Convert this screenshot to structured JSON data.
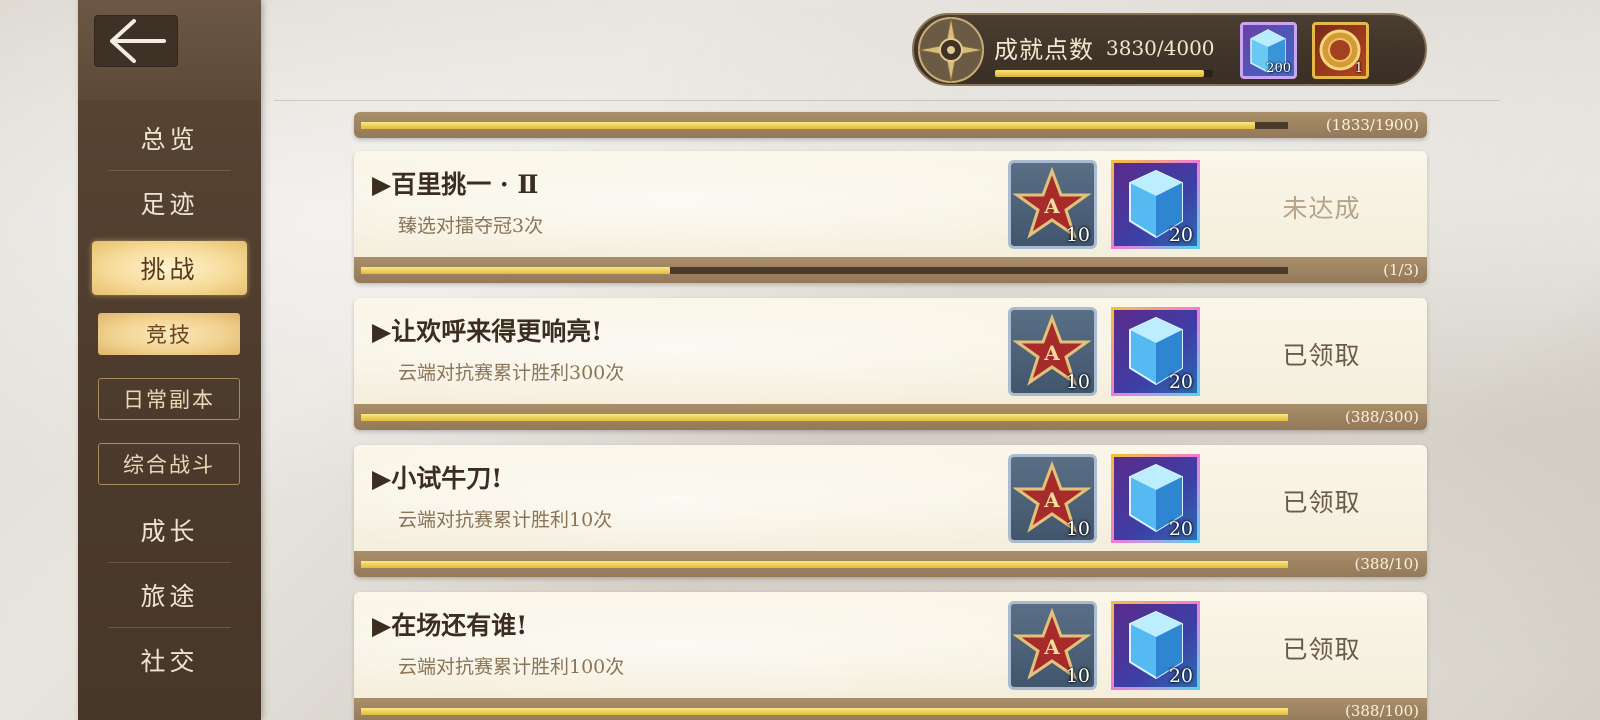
{
  "sidebar": {
    "back_icon": "arrow-left-icon",
    "items": [
      {
        "label": "总览"
      },
      {
        "label": "足迹"
      },
      {
        "label": "挑战"
      },
      {
        "label": "成长"
      },
      {
        "label": "旅途"
      },
      {
        "label": "社交"
      }
    ],
    "sub_items": [
      {
        "label": "竞技"
      },
      {
        "label": "日常副本"
      },
      {
        "label": "综合战斗"
      }
    ]
  },
  "header": {
    "points_label": "成就点数",
    "points_value": "3830/4000",
    "points_progress": 0.9575,
    "rewards": [
      {
        "icon": "blue-crystal-icon",
        "count": "200"
      },
      {
        "icon": "gold-medal-icon",
        "count": "1"
      }
    ]
  },
  "top_card": {
    "progress_text": "(1833/1900)",
    "progress": 0.9647
  },
  "achievements": [
    {
      "title": "▶百里挑一 · Ⅱ",
      "desc": "臻选对擂夺冠3次",
      "reward_a_count": "10",
      "reward_crystal_count": "20",
      "status": "未达成",
      "progress_text": "(1/3)",
      "progress": 0.3333
    },
    {
      "title": "▶让欢呼来得更响亮!",
      "desc": "云端对抗赛累计胜利300次",
      "reward_a_count": "10",
      "reward_crystal_count": "20",
      "status": "已领取",
      "progress_text": "(388/300)",
      "progress": 1.0
    },
    {
      "title": "▶小试牛刀!",
      "desc": "云端对抗赛累计胜利10次",
      "reward_a_count": "10",
      "reward_crystal_count": "20",
      "status": "已领取",
      "progress_text": "(388/10)",
      "progress": 1.0
    },
    {
      "title": "▶在场还有谁!",
      "desc": "云端对抗赛累计胜利100次",
      "reward_a_count": "10",
      "reward_crystal_count": "20",
      "status": "已领取",
      "progress_text": "(388/100)",
      "progress": 1.0
    }
  ],
  "colors": {
    "status_done": "#6a5a48",
    "status_pending": "#b5a489"
  }
}
